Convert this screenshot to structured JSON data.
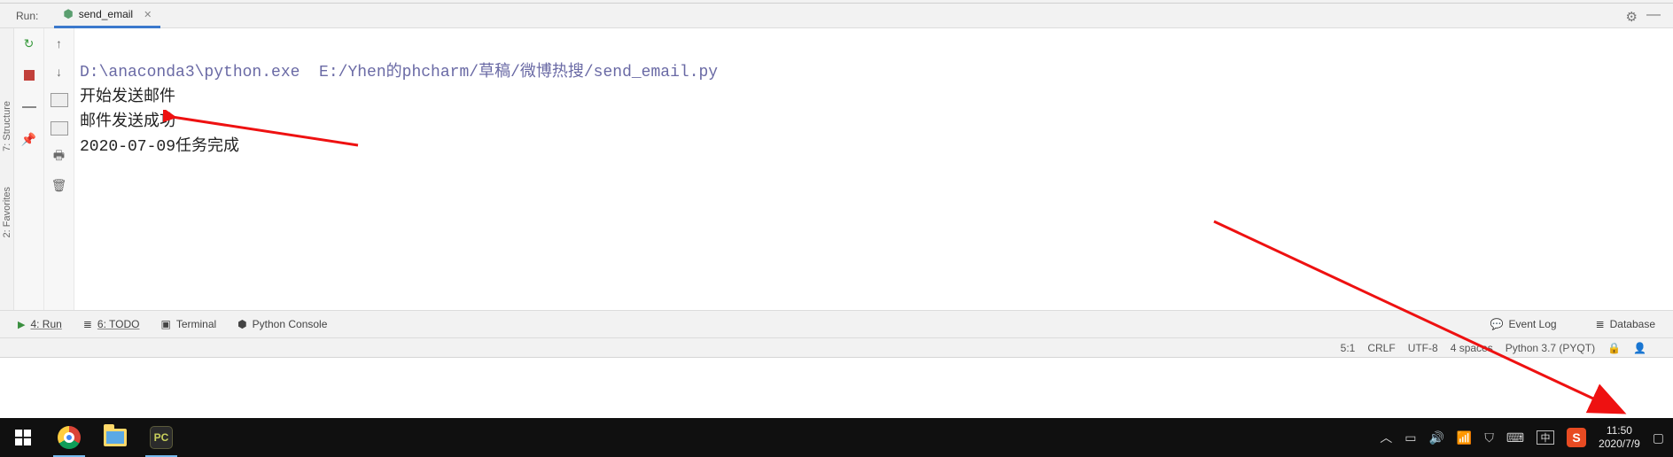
{
  "run_header": {
    "label": "Run:",
    "tab_name": "send_email",
    "gear_icon": "⚙",
    "minimize_icon": "—"
  },
  "side_tabs": {
    "structure": "7: Structure",
    "favorites": "2: Favorites"
  },
  "console": {
    "command": "D:\\anaconda3\\python.exe  E:/Yhen的phcharm/草稿/微博热搜/send_email.py",
    "line1": "开始发送邮件",
    "line2": "邮件发送成功",
    "line3": "2020-07-09任务完成"
  },
  "tool_strip": {
    "run": "4: Run",
    "todo": "6: TODO",
    "terminal": "Terminal",
    "python_console": "Python Console",
    "event_log": "Event Log",
    "database": "Database"
  },
  "status_bar": {
    "pos": "5:1",
    "crlf": "CRLF",
    "encoding": "UTF-8",
    "indent": "4 spaces",
    "interpreter": "Python 3.7 (PYQT)"
  },
  "taskbar": {
    "ime": "中",
    "sogou": "S",
    "time": "11:50",
    "date": "2020/7/9"
  }
}
